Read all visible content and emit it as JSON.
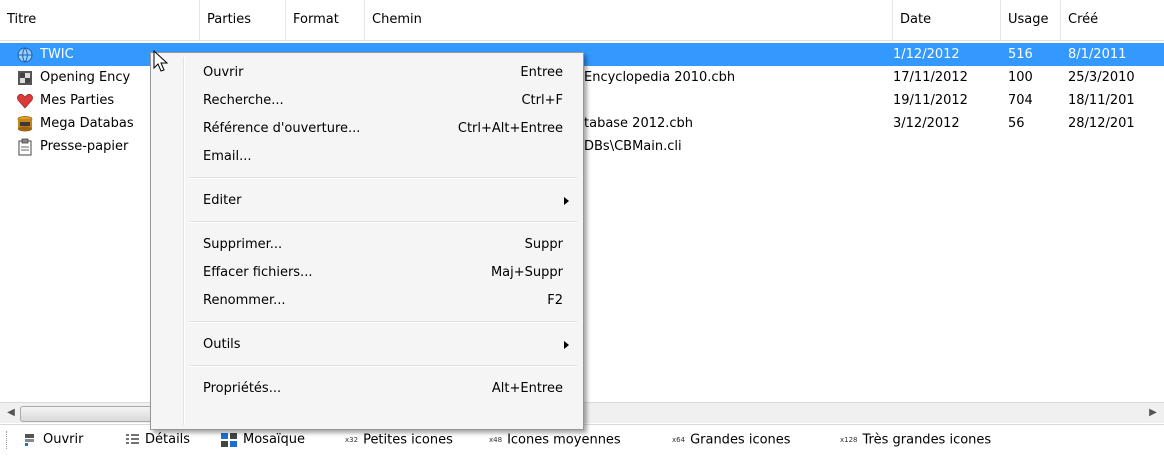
{
  "columns": [
    "Titre",
    "Parties",
    "Format",
    "Chemin",
    "Date",
    "Usage",
    "Créé"
  ],
  "rows": [
    {
      "icon": "globe-icon",
      "title": "TWIC",
      "path": "",
      "date": "1/12/2012",
      "usage": "516",
      "created": "8/1/2011",
      "selected": true
    },
    {
      "icon": "book-icon",
      "title": "Opening Ency",
      "path": "Encyclopedia 2010.cbh",
      "date": "17/11/2012",
      "usage": "100",
      "created": "25/3/2010"
    },
    {
      "icon": "heart-icon",
      "title": "Mes Parties",
      "path": "",
      "date": "19/11/2012",
      "usage": "704",
      "created": "18/11/201"
    },
    {
      "icon": "database-icon",
      "title": "Mega Databas",
      "path": "tabase 2012.cbh",
      "date": "3/12/2012",
      "usage": "56",
      "created": "28/12/201"
    },
    {
      "icon": "clipboard-icon",
      "title": "Presse-papier",
      "path": "DBs\\CBMain.cli",
      "date": "",
      "usage": "",
      "created": ""
    }
  ],
  "context_menu": {
    "items": [
      {
        "label": "Ouvrir",
        "shortcut": "Entree"
      },
      {
        "label": "Recherche...",
        "shortcut": "Ctrl+F"
      },
      {
        "label": "Référence d'ouverture...",
        "shortcut": "Ctrl+Alt+Entree"
      },
      {
        "label": "Email...",
        "shortcut": ""
      },
      {
        "label": "Editer",
        "shortcut": "",
        "submenu": true
      },
      {
        "label": "Supprimer...",
        "shortcut": "Suppr"
      },
      {
        "label": "Effacer fichiers...",
        "shortcut": "Maj+Suppr"
      },
      {
        "label": "Renommer...",
        "shortcut": "F2"
      },
      {
        "label": "Outils",
        "shortcut": "",
        "submenu": true
      },
      {
        "label": "Propriétés...",
        "shortcut": "Alt+Entree"
      }
    ]
  },
  "statusbar": {
    "ouvrir": "Ouvrir",
    "details": "Détails",
    "mosaique": "Mosaïque",
    "petites_size": "x32",
    "petites": "Petites icones",
    "moyennes_size": "x48",
    "moyennes": "Icones moyennes",
    "grandes_size": "x64",
    "grandes": "Grandes icones",
    "tres_grandes_size": "x128",
    "tres_grandes": "Très grandes icones"
  },
  "colors": {
    "selection": "#3399ff",
    "menu_bg": "#f5f5f5"
  }
}
